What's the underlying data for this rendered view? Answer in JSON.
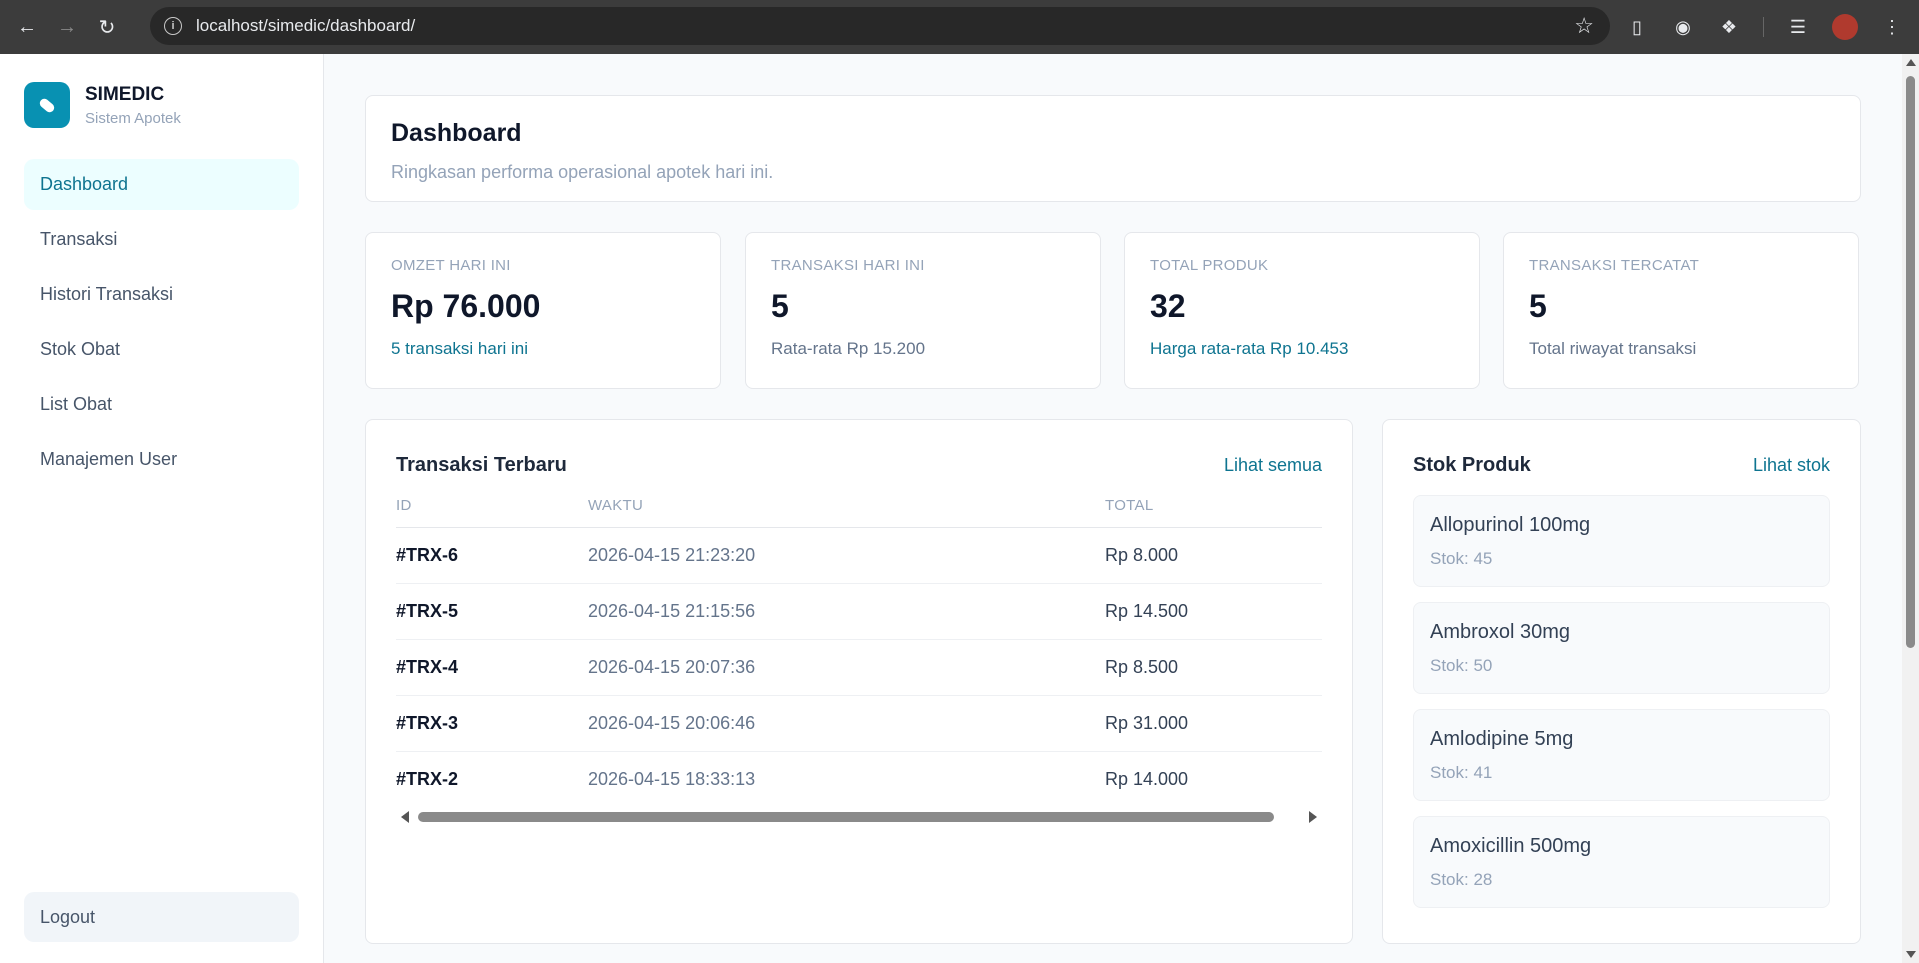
{
  "browser": {
    "url": "localhost/simedic/dashboard/"
  },
  "brand": {
    "name": "SIMEDIC",
    "subtitle": "Sistem Apotek"
  },
  "nav": {
    "items": [
      {
        "label": "Dashboard",
        "active": true
      },
      {
        "label": "Transaksi",
        "active": false
      },
      {
        "label": "Histori Transaksi",
        "active": false
      },
      {
        "label": "Stok Obat",
        "active": false
      },
      {
        "label": "List Obat",
        "active": false
      },
      {
        "label": "Manajemen User",
        "active": false
      }
    ],
    "logout_label": "Logout"
  },
  "header": {
    "title": "Dashboard",
    "subtitle": "Ringkasan performa operasional apotek hari ini."
  },
  "stats": [
    {
      "label": "OMZET HARI INI",
      "value": "Rp 76.000",
      "note": "5 transaksi hari ini"
    },
    {
      "label": "TRANSAKSI HARI INI",
      "value": "5",
      "note": "Rata-rata Rp 15.200"
    },
    {
      "label": "TOTAL PRODUK",
      "value": "32",
      "note": "Harga rata-rata Rp 10.453"
    },
    {
      "label": "TRANSAKSI TERCATAT",
      "value": "5",
      "note": "Total riwayat transaksi"
    }
  ],
  "recent_transactions": {
    "title": "Transaksi Terbaru",
    "link_label": "Lihat semua",
    "columns": [
      "ID",
      "WAKTU",
      "TOTAL"
    ],
    "rows": [
      {
        "id": "#TRX-6",
        "time": "2026-04-15 21:23:20",
        "total": "Rp 8.000"
      },
      {
        "id": "#TRX-5",
        "time": "2026-04-15 21:15:56",
        "total": "Rp 14.500"
      },
      {
        "id": "#TRX-4",
        "time": "2026-04-15 20:07:36",
        "total": "Rp 8.500"
      },
      {
        "id": "#TRX-3",
        "time": "2026-04-15 20:06:46",
        "total": "Rp 31.000"
      },
      {
        "id": "#TRX-2",
        "time": "2026-04-15 18:33:13",
        "total": "Rp 14.000"
      }
    ]
  },
  "stock": {
    "title": "Stok Produk",
    "link_label": "Lihat stok",
    "items": [
      {
        "name": "Allopurinol 100mg",
        "qty": "Stok: 45"
      },
      {
        "name": "Ambroxol 30mg",
        "qty": "Stok: 50"
      },
      {
        "name": "Amlodipine 5mg",
        "qty": "Stok: 41"
      },
      {
        "name": "Amoxicillin 500mg",
        "qty": "Stok: 28"
      }
    ]
  },
  "colors": {
    "accent": "#0891b2",
    "accent_text": "#0e7490",
    "active_nav_bg": "#ecfeff"
  }
}
